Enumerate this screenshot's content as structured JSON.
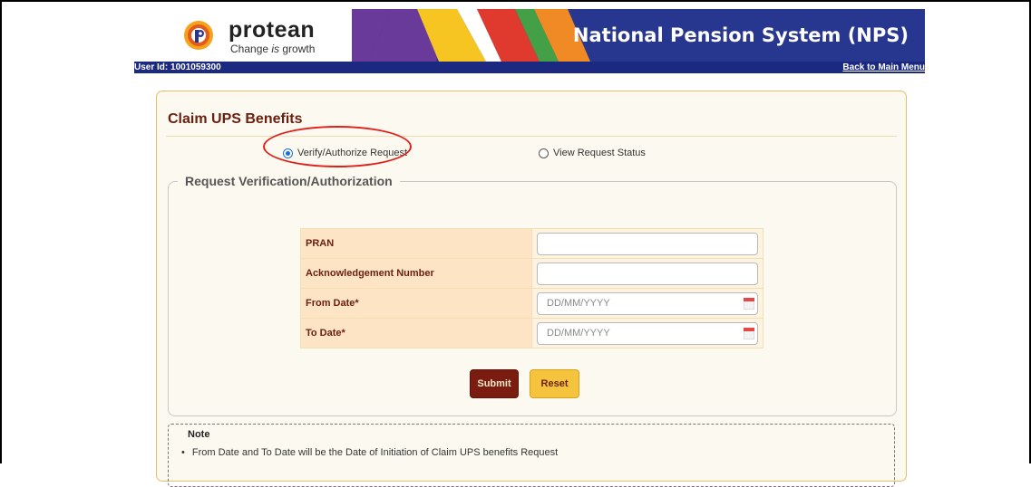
{
  "header": {
    "logo_name": "protean",
    "tagline_pre": "Change ",
    "tagline_em": "is",
    "tagline_post": " growth",
    "title": "National Pension System (NPS)",
    "user_id": "User Id: 1001059300",
    "back_link": "Back to Main Menu",
    "brand_color": "#27368f"
  },
  "main": {
    "title": "Claim UPS Benefits",
    "radios": [
      {
        "label": "Verify/Authorize Request",
        "checked": true
      },
      {
        "label": "View Request Status",
        "checked": false
      }
    ],
    "section_title": "Request Verification/Authorization",
    "fields": [
      {
        "label": "PRAN",
        "value": "",
        "placeholder": ""
      },
      {
        "label": "Acknowledgement Number",
        "value": "",
        "placeholder": ""
      },
      {
        "label": "From Date*",
        "value": "",
        "placeholder": "DD/MM/YYYY",
        "icon": "calendar-icon"
      },
      {
        "label": "To Date*",
        "value": "",
        "placeholder": "DD/MM/YYYY",
        "icon": "calendar-icon"
      }
    ],
    "submit_label": "Submit",
    "reset_label": "Reset"
  },
  "note": {
    "title": "Note",
    "items": [
      "From Date and To Date will be the Date of Initiation of Claim UPS benefits Request"
    ]
  }
}
